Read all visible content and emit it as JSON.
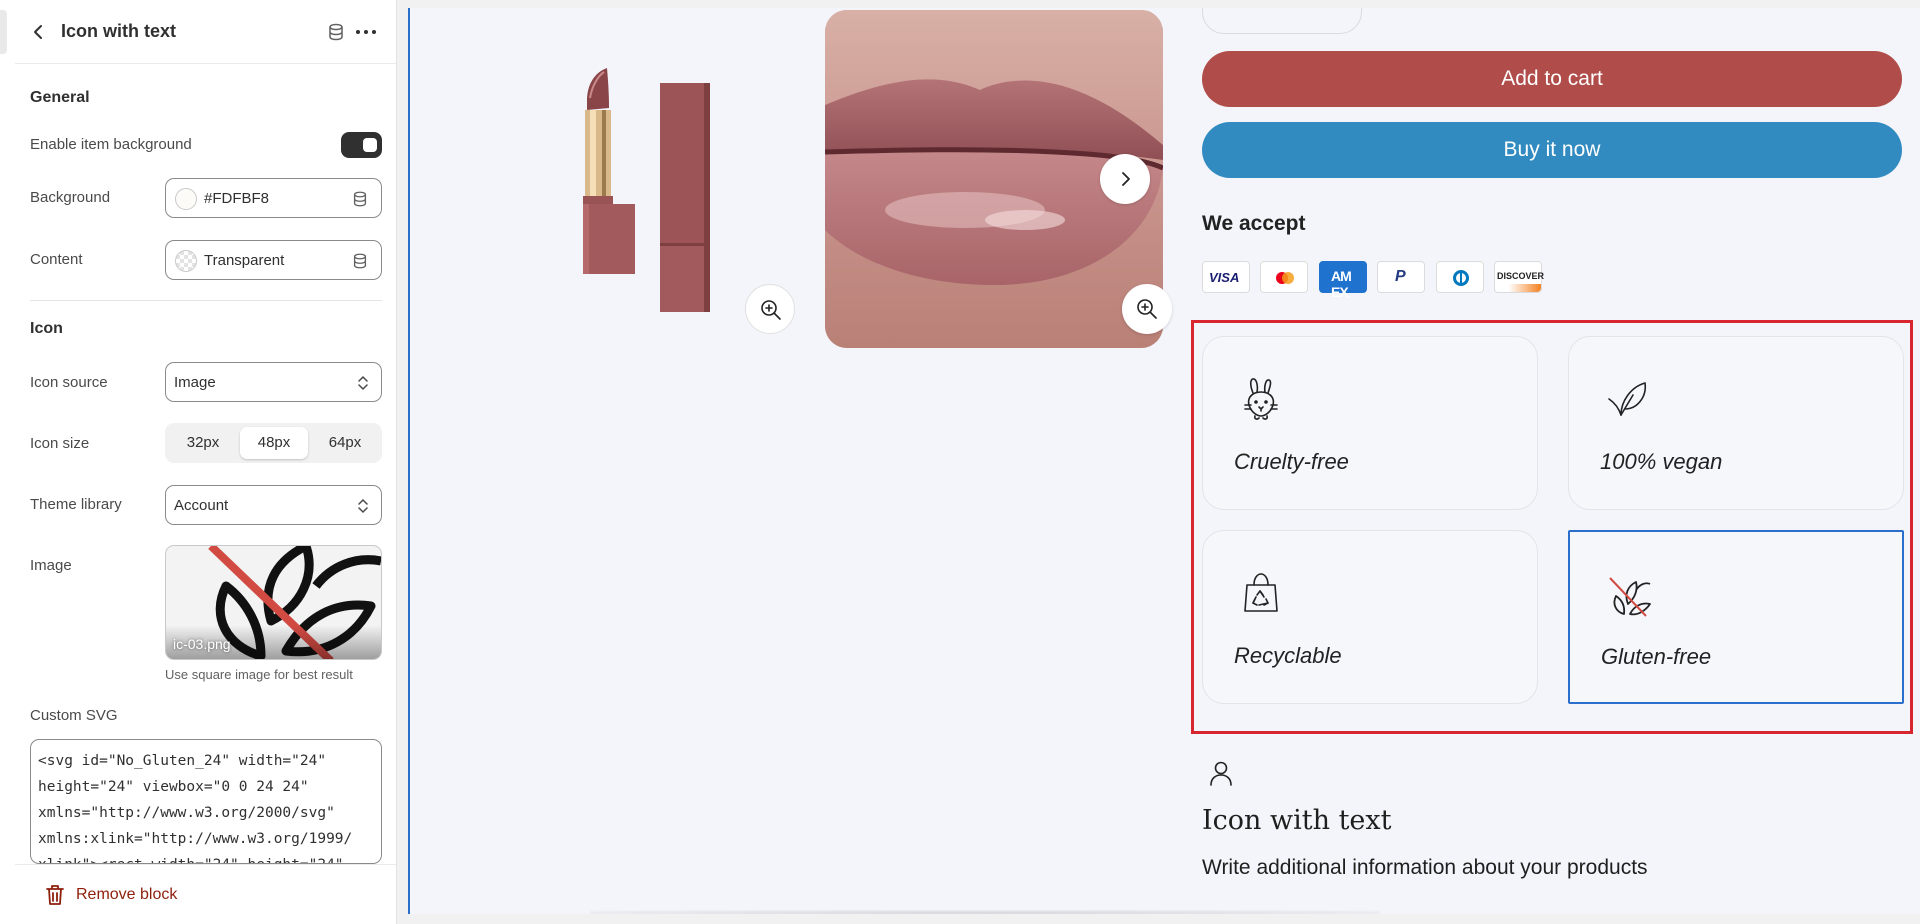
{
  "panel": {
    "title": "Icon with text",
    "general": {
      "heading": "General",
      "enable_background_label": "Enable item background",
      "enable_background_on": true,
      "background_label": "Background",
      "background_value": "#FDFBF8",
      "content_label": "Content",
      "content_value": "Transparent"
    },
    "icon": {
      "heading": "Icon",
      "source_label": "Icon source",
      "source_value": "Image",
      "size_label": "Icon size",
      "size_options": [
        "32px",
        "48px",
        "64px"
      ],
      "size_selected": "48px",
      "library_label": "Theme library",
      "library_value": "Account",
      "image_label": "Image",
      "image_filename": "ic-03.png",
      "image_hint": "Use square image for best result"
    },
    "custom_svg": {
      "label": "Custom SVG",
      "lines": [
        "<svg id=\"No_Gluten_24\" width=\"24\"",
        "height=\"24\" viewbox=\"0 0 24 24\"",
        "xmlns=\"http://www.w3.org/2000/svg\"",
        "xmlns:xlink=\"http://www.w3.org/1999/",
        "xlink\"><rect width=\"24\" height=\"24\""
      ]
    },
    "remove_label": "Remove block"
  },
  "product": {
    "add_to_cart": "Add to cart",
    "buy_now": "Buy it now",
    "we_accept": "We accept",
    "payment_methods": [
      "VISA",
      "Mastercard",
      "American Express",
      "PayPal",
      "Diners Club",
      "DISCOVER"
    ],
    "features": [
      {
        "label": "Cruelty-free",
        "icon": "rabbit-icon"
      },
      {
        "label": "100% vegan",
        "icon": "leaf-icon"
      },
      {
        "label": "Recyclable",
        "icon": "recycle-bag-icon"
      },
      {
        "label": "Gluten-free",
        "icon": "no-gluten-icon"
      }
    ],
    "icon_with_text_title": "Icon with text",
    "icon_with_text_desc": "Write additional information about your products"
  },
  "colors": {
    "accent_blue": "#2c6ecb",
    "add_to_cart": "#b04d4a",
    "buy_now": "#318bc0",
    "selection_outline": "#d7262f",
    "remove": "#8e1f0b"
  }
}
